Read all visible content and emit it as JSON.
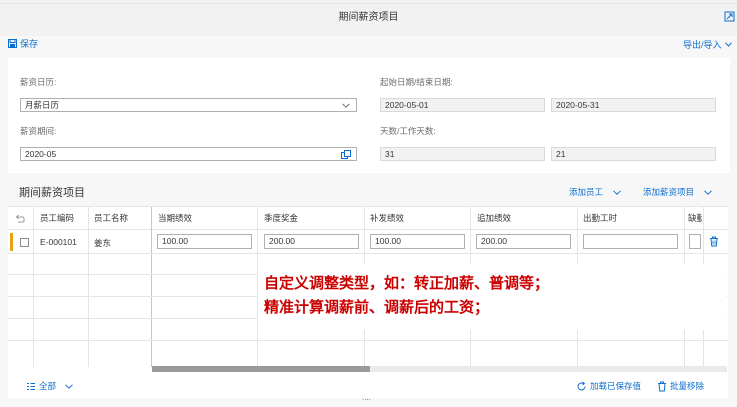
{
  "window": {
    "title": "期间薪资项目"
  },
  "toolbar": {
    "save_label": "保存",
    "export_label": "导出/导入"
  },
  "form": {
    "calendar_label": "薪资日历:",
    "calendar_value": "月薪日历",
    "period_label": "薪资期间:",
    "period_value": "2020-05",
    "dates_label": "起始日期/结束日期:",
    "start_date": "2020-05-01",
    "end_date": "2020-05-31",
    "days_label": "天数/工作天数:",
    "days": "31",
    "work_days": "21"
  },
  "section": {
    "title": "期间薪资项目",
    "add_employee": "添加员工",
    "add_item": "添加薪资项目"
  },
  "table": {
    "headers": [
      "员工编码",
      "员工名称",
      "当期绩效",
      "季度奖金",
      "补发绩效",
      "追加绩效",
      "出勤工时",
      "缺勤"
    ],
    "row": {
      "code": "E-000101",
      "name": "姜东",
      "values": [
        "100.00",
        "200.00",
        "100.00",
        "200.00",
        "",
        ""
      ]
    }
  },
  "annotation": {
    "line1": "自定义调整类型，如：转正加薪、普调等；",
    "line2": "精准计算调薪前、调薪后的工资；"
  },
  "footer": {
    "all_label": "全部",
    "load_saved": "加载已保存值",
    "batch_remove": "批量移除",
    "ellipsis": "...."
  },
  "colors": {
    "accent": "#0a6ed1",
    "annotation": "#cc0000",
    "selection": "#e8a317"
  }
}
